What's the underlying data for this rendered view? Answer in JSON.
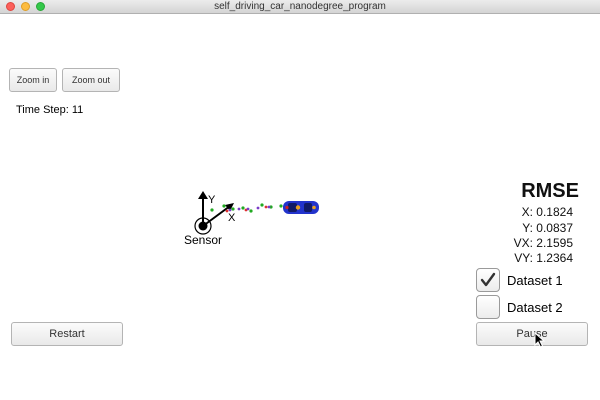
{
  "window": {
    "title": "self_driving_car_nanodegree_program"
  },
  "toolbar": {
    "zoom_in_label": "Zoom in",
    "zoom_out_label": "Zoom out"
  },
  "status": {
    "time_step": "Time Step: 11"
  },
  "rmse": {
    "title": "RMSE",
    "x": "X: 0.1824",
    "y": "Y: 0.0837",
    "vx": "VX: 2.1595",
    "vy": "VY: 1.2364"
  },
  "datasets": [
    {
      "label": "Dataset 1",
      "checked": true
    },
    {
      "label": "Dataset 2",
      "checked": false
    }
  ],
  "scene": {
    "sensor_label": "Sensor",
    "axis_x_label": "X",
    "axis_y_label": "Y",
    "car_color": "#2233cc",
    "measurement_color": "#22aa22",
    "estimate_color": "#7a3cc8"
  },
  "controls": {
    "restart_label": "Restart",
    "pause_label": "Pause"
  },
  "icons": {
    "checkmark": "checkmark-icon",
    "cursor": "cursor-arrow-icon",
    "car": "car-icon"
  }
}
